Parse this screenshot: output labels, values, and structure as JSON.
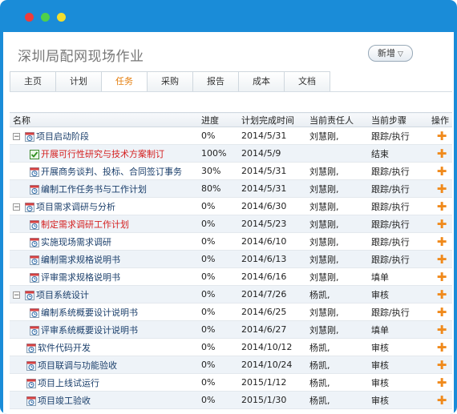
{
  "window": {
    "controls": [
      "close",
      "minimize",
      "zoom"
    ]
  },
  "app": {
    "title": "深圳局配网现场作业",
    "new_button": "新增",
    "new_caret": "▽"
  },
  "tabs": [
    "主页",
    "计划",
    "任务",
    "采购",
    "报告",
    "成本",
    "文档"
  ],
  "active_tab": "任务",
  "columns": [
    "名称",
    "进度",
    "计划完成时间",
    "当前责任人",
    "当前步骤",
    "操作"
  ],
  "rows": [
    {
      "name": "项目启动阶段",
      "progress": "0%",
      "date": "2014/5/31",
      "owner": "刘慧刚,",
      "step": "跟踪/执行",
      "level": 0,
      "group": true,
      "icon": "clock",
      "color": "normal"
    },
    {
      "name": "开展可行性研究与技术方案制订",
      "progress": "100%",
      "date": "2014/5/9",
      "owner": "",
      "step": "结束",
      "level": 1,
      "group": false,
      "icon": "check",
      "color": "red"
    },
    {
      "name": "开展商务谈判、投标、合同签订事务",
      "progress": "30%",
      "date": "2014/5/31",
      "owner": "刘慧刚,",
      "step": "跟踪/执行",
      "level": 1,
      "group": false,
      "icon": "clock",
      "color": "normal"
    },
    {
      "name": "编制工作任务书与工作计划",
      "progress": "80%",
      "date": "2014/5/31",
      "owner": "刘慧刚,",
      "step": "跟踪/执行",
      "level": 1,
      "group": false,
      "icon": "clock",
      "color": "normal"
    },
    {
      "name": "项目需求调研与分析",
      "progress": "0%",
      "date": "2014/6/30",
      "owner": "刘慧刚,",
      "step": "跟踪/执行",
      "level": 0,
      "group": true,
      "icon": "clock",
      "color": "normal"
    },
    {
      "name": "制定需求调研工作计划",
      "progress": "0%",
      "date": "2014/5/23",
      "owner": "刘慧刚,",
      "step": "跟踪/执行",
      "level": 1,
      "group": false,
      "icon": "clock",
      "color": "red"
    },
    {
      "name": "实施现场需求调研",
      "progress": "0%",
      "date": "2014/6/10",
      "owner": "刘慧刚,",
      "step": "跟踪/执行",
      "level": 1,
      "group": false,
      "icon": "clock",
      "color": "normal"
    },
    {
      "name": "编制需求规格说明书",
      "progress": "0%",
      "date": "2014/6/13",
      "owner": "刘慧刚,",
      "step": "跟踪/执行",
      "level": 1,
      "group": false,
      "icon": "clock",
      "color": "normal"
    },
    {
      "name": "评审需求规格说明书",
      "progress": "0%",
      "date": "2014/6/16",
      "owner": "刘慧刚,",
      "step": "填单",
      "level": 1,
      "group": false,
      "icon": "clock",
      "color": "normal"
    },
    {
      "name": "项目系统设计",
      "progress": "0%",
      "date": "2014/7/26",
      "owner": "杨凯,",
      "step": "审核",
      "level": 0,
      "group": true,
      "icon": "clock",
      "color": "normal"
    },
    {
      "name": "编制系统概要设计说明书",
      "progress": "0%",
      "date": "2014/6/25",
      "owner": "刘慧刚,",
      "step": "跟踪/执行",
      "level": 1,
      "group": false,
      "icon": "clock",
      "color": "normal"
    },
    {
      "name": "评审系统概要设计说明书",
      "progress": "0%",
      "date": "2014/6/27",
      "owner": "刘慧刚,",
      "step": "填单",
      "level": 1,
      "group": false,
      "icon": "clock",
      "color": "normal"
    },
    {
      "name": "软件代码开发",
      "progress": "0%",
      "date": "2014/10/12",
      "owner": "杨凯,",
      "step": "审核",
      "level": 0,
      "group": false,
      "icon": "clock",
      "color": "normal"
    },
    {
      "name": "项目联调与功能验收",
      "progress": "0%",
      "date": "2014/10/24",
      "owner": "杨凯,",
      "step": "审核",
      "level": 0,
      "group": false,
      "icon": "clock",
      "color": "normal"
    },
    {
      "name": "项目上线试运行",
      "progress": "0%",
      "date": "2015/1/12",
      "owner": "杨凯,",
      "step": "审核",
      "level": 0,
      "group": false,
      "icon": "clock",
      "color": "normal"
    },
    {
      "name": "项目竣工验收",
      "progress": "0%",
      "date": "2015/1/30",
      "owner": "杨凯,",
      "step": "审核",
      "level": 0,
      "group": false,
      "icon": "clock",
      "color": "normal"
    }
  ],
  "action_symbol": "✚",
  "toggle_symbol": "−",
  "colors": {
    "frame": "#1a8cd8",
    "accent": "#e57d0b",
    "link": "#1b3f6b",
    "overdue": "#d42020",
    "action": "#f08a1c"
  }
}
